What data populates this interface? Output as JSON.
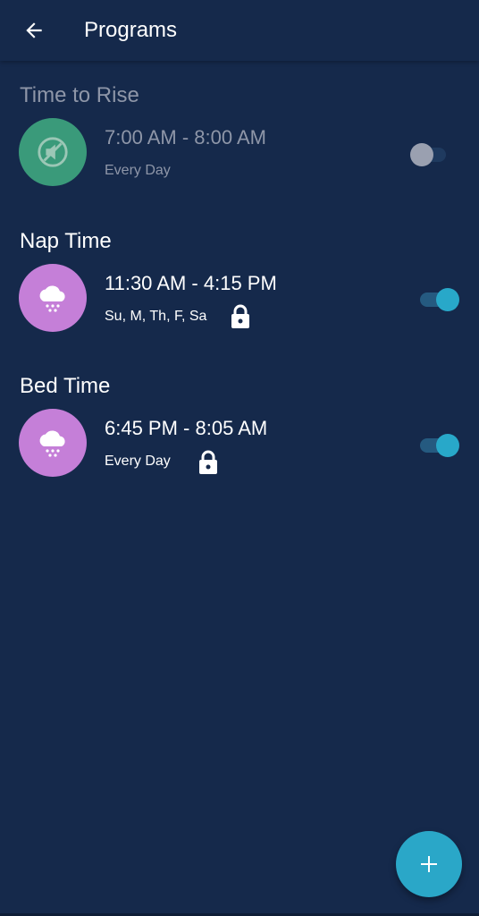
{
  "header": {
    "title": "Programs",
    "back_icon": "arrow-left-icon"
  },
  "programs": [
    {
      "name": "Time to Rise",
      "time": "7:00 AM - 8:00 AM",
      "days": "Every Day",
      "icon": "sound-off-icon",
      "icon_color": "#3a9a7a",
      "enabled": false,
      "locked": false
    },
    {
      "name": "Nap Time",
      "time": "11:30 AM - 4:15 PM",
      "days": "Su, M, Th, F, Sa",
      "icon": "rain-cloud-icon",
      "icon_color": "#c57fd8",
      "enabled": true,
      "locked": true
    },
    {
      "name": "Bed Time",
      "time": "6:45 PM - 8:05 AM",
      "days": "Every Day",
      "icon": "rain-cloud-icon",
      "icon_color": "#c57fd8",
      "enabled": true,
      "locked": true
    }
  ],
  "fab": {
    "icon": "plus-icon"
  },
  "colors": {
    "background": "#15294b",
    "accent": "#2aa7c8"
  }
}
